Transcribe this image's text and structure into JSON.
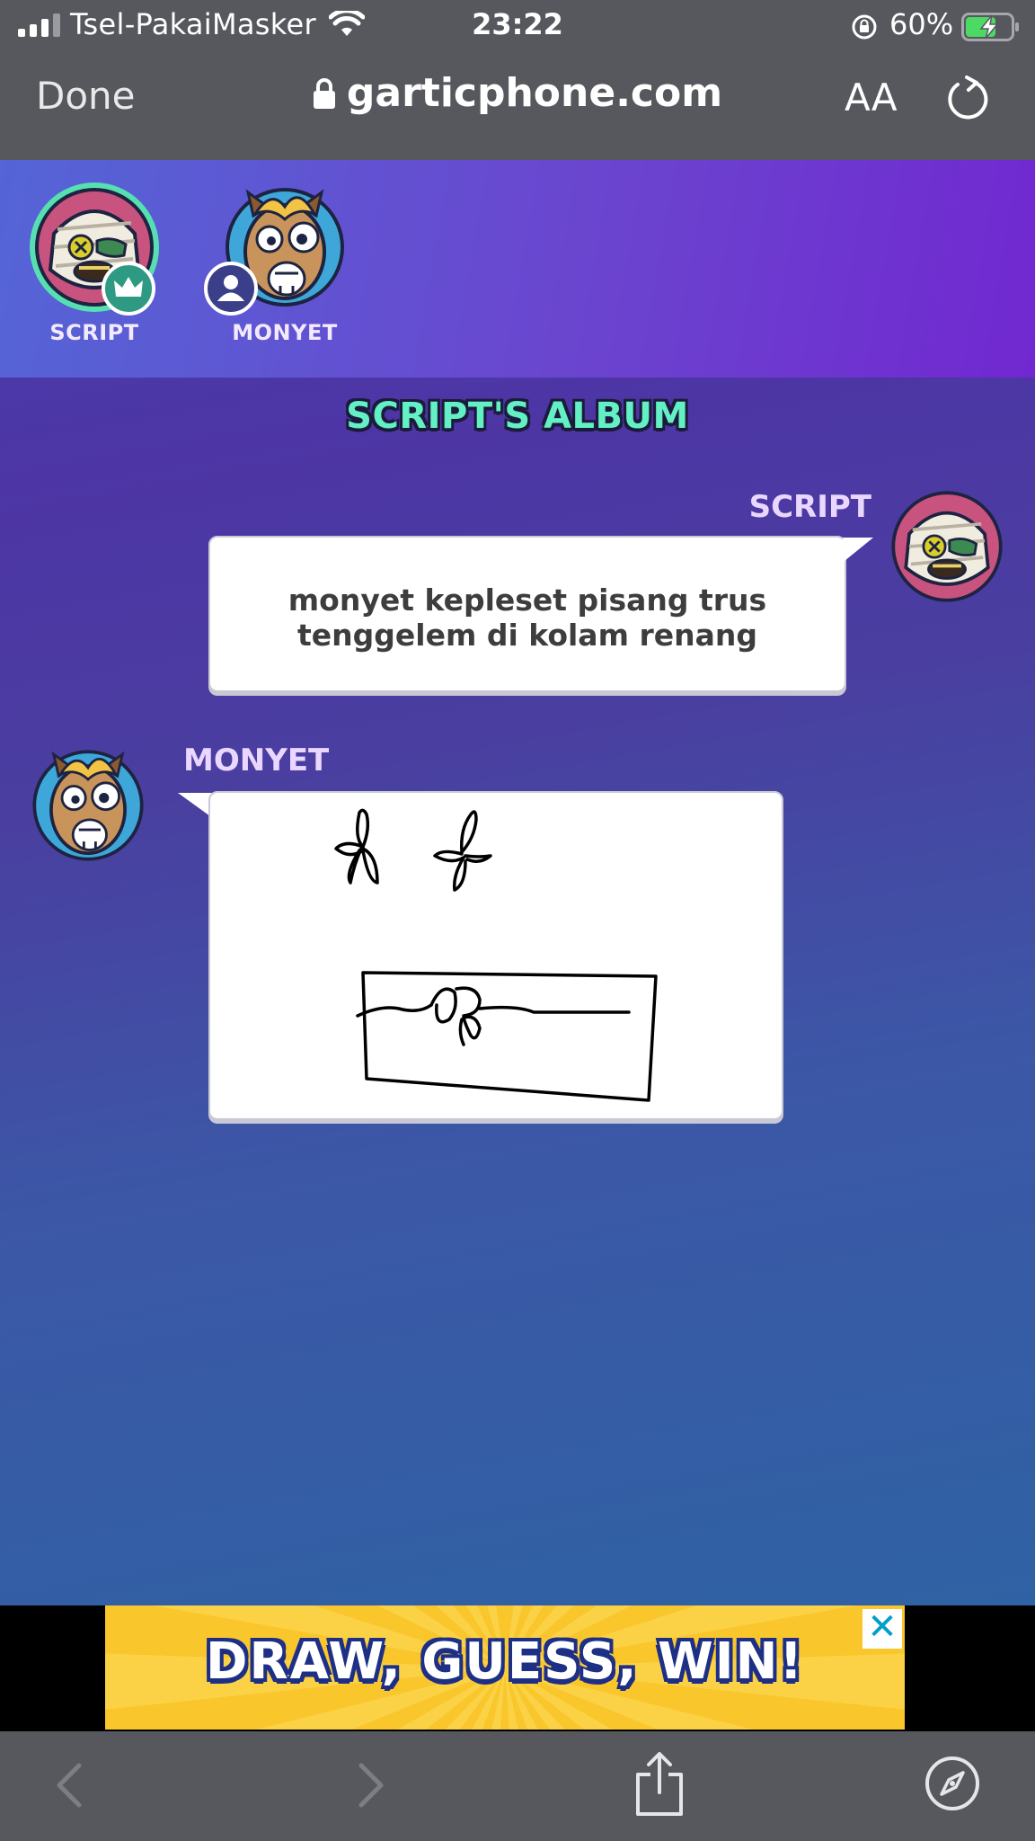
{
  "status_bar": {
    "carrier": "Tsel-PakaiMasker",
    "time": "23:22",
    "battery_percent": "60%"
  },
  "browser": {
    "done_label": "Done",
    "url": "garticphone.com",
    "text_size_label": "AA"
  },
  "players": [
    {
      "name": "SCRIPT",
      "avatar": "mummy-avatar",
      "badge": "crown-icon"
    },
    {
      "name": "MONYET",
      "avatar": "llama-avatar",
      "badge": "user-icon"
    }
  ],
  "album": {
    "title": "SCRIPT'S ALBUM",
    "entries": [
      {
        "author": "SCRIPT",
        "type": "text",
        "text": "monyet kepleset pisang trus tenggelem di kolam renang"
      },
      {
        "author": "MONYET",
        "type": "drawing",
        "description": ""
      }
    ]
  },
  "ad": {
    "headline": "DRAW, GUESS, WIN!",
    "close_label": "✕"
  },
  "toolbar": {
    "icons": [
      "back-icon",
      "forward-icon",
      "share-icon",
      "compass-icon"
    ]
  },
  "colors": {
    "accent": "#63f0c4",
    "author_name": "#ead7ff",
    "browser_chrome": "#56585d",
    "ad_yellow": "#f9c62c",
    "ad_text_outline": "#1e2f86"
  }
}
